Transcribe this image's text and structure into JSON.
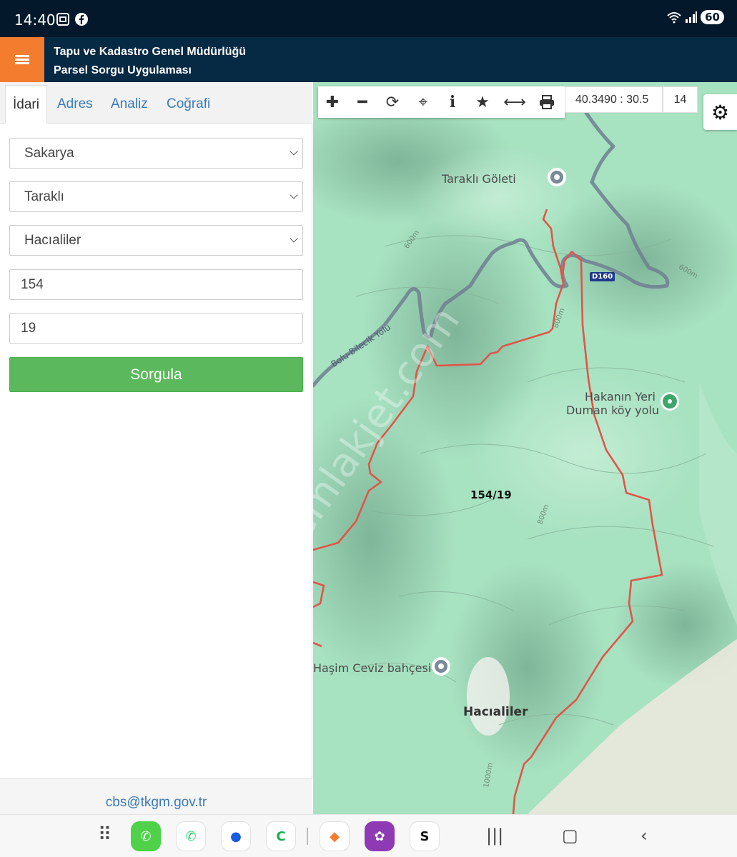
{
  "status": {
    "time": "14:40",
    "battery": "60"
  },
  "header": {
    "line1": "Tapu ve Kadastro Genel Müdürlüğü",
    "line2": "Parsel Sorgu Uygulaması"
  },
  "tabs": [
    "İdari",
    "Adres",
    "Analiz",
    "Coğrafi"
  ],
  "form": {
    "il": "Sakarya",
    "ilce": "Taraklı",
    "mahalle": "Hacıaliler",
    "ada": "154",
    "parsel": "19",
    "submit_label": "Sorgula"
  },
  "footer": {
    "email": "cbs@tkgm.gov.tr"
  },
  "toolbar": {
    "coord": "40.3490 : 30.5",
    "zoom": "14"
  },
  "map": {
    "parcel_label": "154/19",
    "places": [
      "Taraklı Göleti",
      "Hakanın Yeri",
      "Duman köy yolu",
      "Haşim Ceviz bahçesi",
      "Hacıaliler"
    ],
    "road_label": "Bolu-Bilecik Yolu",
    "road_shield": "D160",
    "contours": [
      "600m",
      "600m",
      "800m",
      "800m",
      "1000m"
    ],
    "watermark": "emlakjet.com",
    "parcel_color": "#e0554a",
    "terrain_color": "#a7e2c1"
  }
}
